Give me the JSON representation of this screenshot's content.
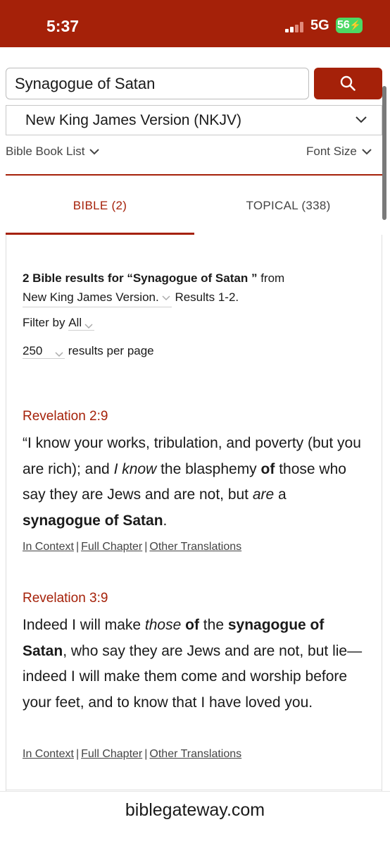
{
  "status_bar": {
    "time": "5:37",
    "network": "5G",
    "battery": "56",
    "bg_color": "#a52109"
  },
  "search": {
    "value": "Synagogue of Satan",
    "button_icon": "search-icon"
  },
  "version_select": {
    "selected": "New King James Version (NKJV)"
  },
  "toolbar": {
    "book_list": "Bible Book List",
    "font_size": "Font Size"
  },
  "tabs": [
    {
      "label": "BIBLE (2)",
      "active": true
    },
    {
      "label": "TOPICAL (338)",
      "active": false
    }
  ],
  "summary": {
    "count_prefix": "2 Bible results for “Synagogue of Satan ”",
    "from": "from",
    "version": "New King James Version.",
    "range": "Results 1-2.",
    "filter_label": "Filter by",
    "filter_value": "All",
    "per_page_value": "250",
    "per_page_label": "results per page"
  },
  "results": [
    {
      "reference": "Revelation 2:9",
      "text_parts": [
        {
          "t": "“I know your works, tribulation, and poverty (but you are rich); and ",
          "s": "n"
        },
        {
          "t": "I know",
          "s": "i"
        },
        {
          "t": " the blasphemy ",
          "s": "n"
        },
        {
          "t": "of",
          "s": "b"
        },
        {
          "t": " those who say they are Jews and are not, but ",
          "s": "n"
        },
        {
          "t": "are",
          "s": "i"
        },
        {
          "t": " a ",
          "s": "n"
        },
        {
          "t": "synagogue of Satan",
          "s": "b"
        },
        {
          "t": ".",
          "s": "n"
        }
      ],
      "links": [
        "In Context",
        "Full Chapter",
        "Other Translations"
      ]
    },
    {
      "reference": "Revelation 3:9",
      "text_parts": [
        {
          "t": "Indeed I will make ",
          "s": "n"
        },
        {
          "t": "those",
          "s": "i"
        },
        {
          "t": " ",
          "s": "n"
        },
        {
          "t": "of",
          "s": "b"
        },
        {
          "t": " the ",
          "s": "n"
        },
        {
          "t": "synagogue of Satan",
          "s": "b"
        },
        {
          "t": ", who say they are Jews and are not, but lie—indeed I will make them come and worship before your feet, and to know that I have loved you.",
          "s": "n"
        }
      ],
      "links": [
        "In Context",
        "Full Chapter",
        "Other Translations"
      ]
    }
  ],
  "url_bar": {
    "url": "biblegateway.com"
  },
  "colors": {
    "brand": "#a52109",
    "battery": "#4cd964"
  }
}
